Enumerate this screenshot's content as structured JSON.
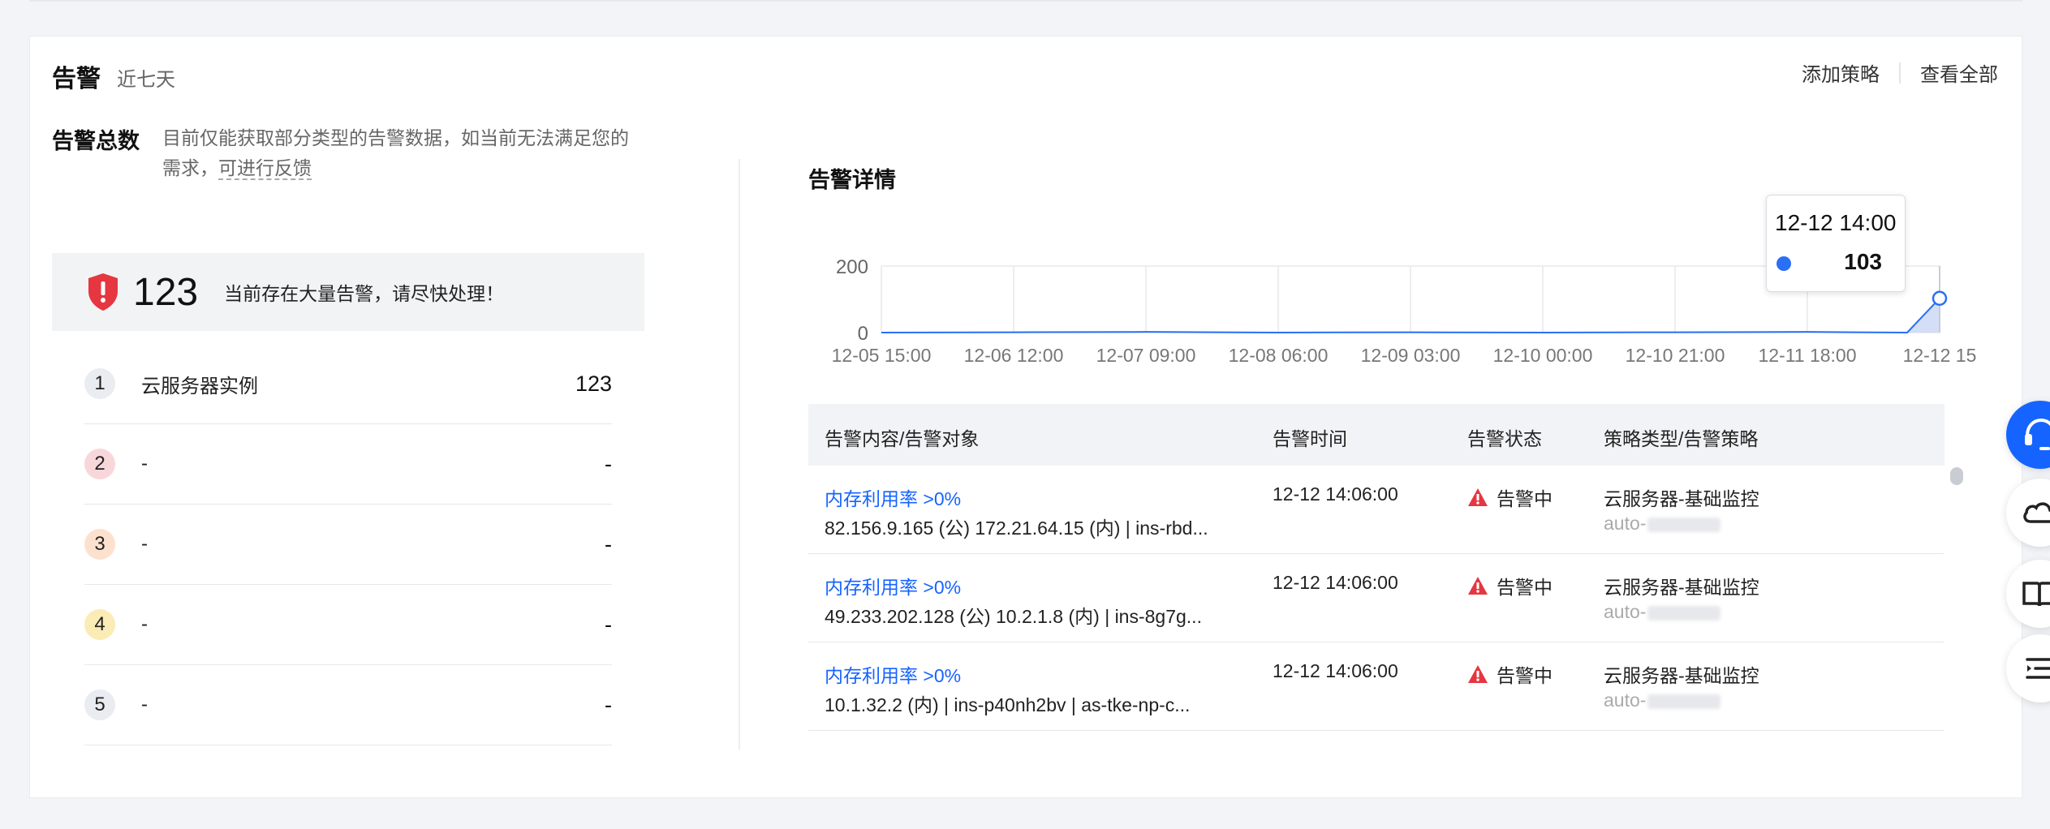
{
  "header": {
    "title": "告警",
    "subtitle": "近七天",
    "actions": [
      "添加策略",
      "查看全部"
    ]
  },
  "summary": {
    "title": "告警总数",
    "note": "目前仅能获取部分类型的告警数据，如当前无法满足您的需求，",
    "feedback": "可进行反馈",
    "count": "123",
    "message": "当前存在大量告警，请尽快处理！",
    "rank": [
      {
        "n": "1",
        "name": "云服务器实例",
        "value": "123"
      },
      {
        "n": "2",
        "name": "-",
        "value": "-"
      },
      {
        "n": "3",
        "name": "-",
        "value": "-"
      },
      {
        "n": "4",
        "name": "-",
        "value": "-"
      },
      {
        "n": "5",
        "name": "-",
        "value": "-"
      }
    ]
  },
  "detail": {
    "title": "告警详情",
    "tooltip": {
      "time": "12-12 14:00",
      "value": "103"
    },
    "table": {
      "headers": [
        "告警内容/告警对象",
        "告警时间",
        "告警状态",
        "策略类型/告警策略"
      ],
      "rows": [
        {
          "name": "内存利用率 >0%",
          "object": "82.156.9.165 (公) 172.21.64.15 (内) | ins-rbd...",
          "time": "12-12 14:06:00",
          "status": "告警中",
          "policy": "云服务器-基础监控",
          "policy_sub": "auto-"
        },
        {
          "name": "内存利用率 >0%",
          "object": "49.233.202.128 (公) 10.2.1.8 (内) | ins-8g7g...",
          "time": "12-12 14:06:00",
          "status": "告警中",
          "policy": "云服务器-基础监控",
          "policy_sub": "auto-"
        },
        {
          "name": "内存利用率 >0%",
          "object": "10.1.32.2 (内) | ins-p40nh2bv | as-tke-np-c...",
          "time": "12-12 14:06:00",
          "status": "告警中",
          "policy": "云服务器-基础监控",
          "policy_sub": "auto-"
        }
      ]
    }
  },
  "chart_data": {
    "type": "area",
    "x": [
      "12-05 15:00",
      "12-06 12:00",
      "12-07 09:00",
      "12-08 06:00",
      "12-09 03:00",
      "12-10 00:00",
      "12-10 21:00",
      "12-11 18:00",
      "12-12 15"
    ],
    "yticks": [
      "0",
      "200"
    ],
    "ylim": [
      0,
      200
    ],
    "series": [
      {
        "values": [
          0,
          1,
          2,
          0,
          1,
          0,
          1,
          2,
          103
        ]
      }
    ],
    "colors": {
      "line": "#2a6ff6",
      "fill": "#c9d7f5",
      "grid": "#eceef1"
    }
  },
  "colors": {
    "accent": "#1664ff",
    "danger": "#e63640"
  }
}
